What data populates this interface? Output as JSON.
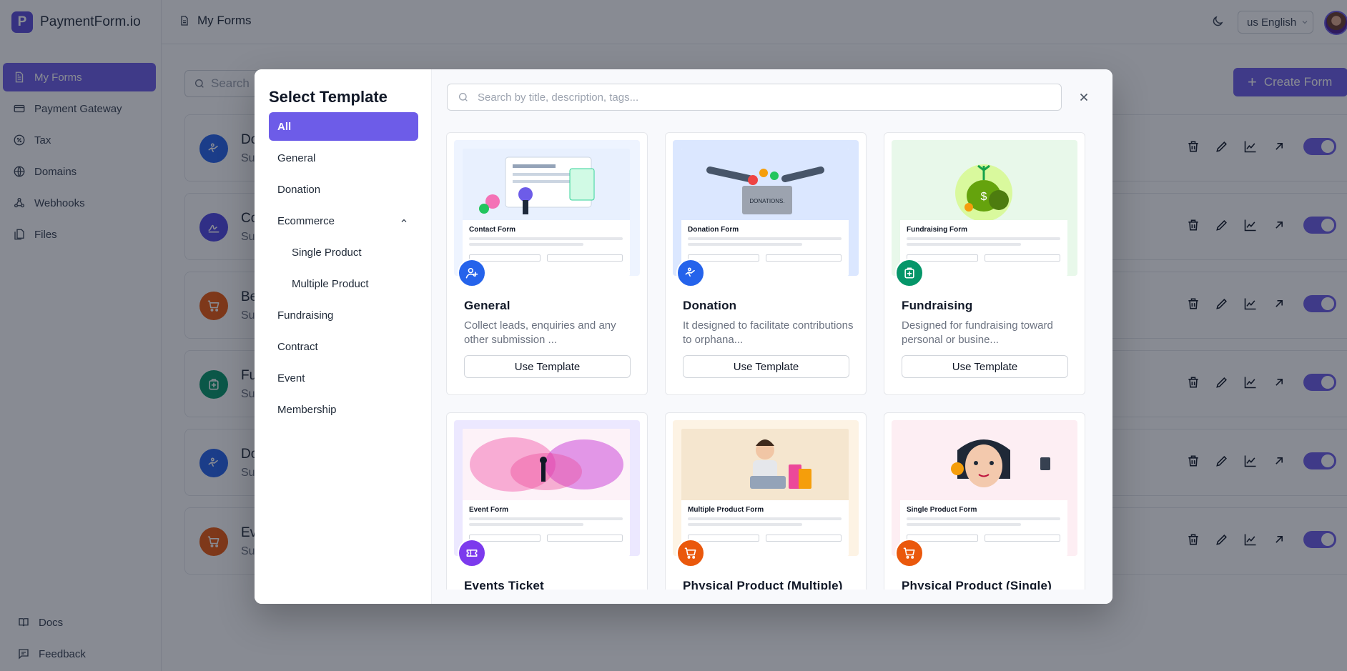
{
  "app": {
    "brand_letter": "P",
    "brand_name": "PaymentForm.io"
  },
  "sidebar": {
    "items": [
      {
        "label": "My Forms",
        "icon": "file-icon",
        "active": true
      },
      {
        "label": "Payment Gateway",
        "icon": "card-icon"
      },
      {
        "label": "Tax",
        "icon": "percent-icon"
      },
      {
        "label": "Domains",
        "icon": "globe-icon"
      },
      {
        "label": "Webhooks",
        "icon": "webhook-icon"
      },
      {
        "label": "Files",
        "icon": "files-icon"
      }
    ],
    "bottom": [
      {
        "label": "Docs",
        "icon": "book-icon"
      },
      {
        "label": "Feedback",
        "icon": "message-icon"
      }
    ]
  },
  "header": {
    "title": "My Forms",
    "language": "us English"
  },
  "main": {
    "search_placeholder": "Search",
    "create_label": "Create Form",
    "forms": [
      {
        "name": "Do",
        "sub": "Su",
        "icon": "donation-icon",
        "color": "#2563eb"
      },
      {
        "name": "Co",
        "sub": "Su",
        "icon": "signature-icon",
        "color": "#4f46e5"
      },
      {
        "name": "Be",
        "sub": "Su",
        "icon": "cart-icon",
        "color": "#ea580c"
      },
      {
        "name": "Fu",
        "sub": "Su",
        "icon": "fundraising-icon",
        "color": "#059669"
      },
      {
        "name": "Do",
        "sub": "Su",
        "icon": "donation-icon",
        "color": "#2563eb"
      },
      {
        "name": "Ev",
        "sub": "Su",
        "icon": "cart-icon",
        "color": "#ea580c"
      }
    ]
  },
  "modal": {
    "title": "Select Template",
    "search_placeholder": "Search by title, description, tags...",
    "categories": [
      {
        "label": "All",
        "active": true
      },
      {
        "label": "General"
      },
      {
        "label": "Donation"
      },
      {
        "label": "Ecommerce",
        "expanded": true
      },
      {
        "label": "Single Product",
        "sub": true
      },
      {
        "label": "Multiple Product",
        "sub": true
      },
      {
        "label": "Fundraising"
      },
      {
        "label": "Contract"
      },
      {
        "label": "Event"
      },
      {
        "label": "Membership"
      }
    ],
    "use_label": "Use Template",
    "templates": [
      {
        "name": "General",
        "desc": "Collect leads, enquiries and any other submission ...",
        "thumb_title": "Contact Form",
        "icon": "user-plus-icon",
        "color": "#2563eb",
        "bg": "#eef4ff"
      },
      {
        "name": "Donation",
        "desc": "It designed to facilitate contributions to orphana...",
        "thumb_title": "Donation Form",
        "icon": "donation-icon",
        "color": "#2563eb",
        "bg": "#dbe7ff"
      },
      {
        "name": "Fundraising",
        "desc": "Designed for fundraising toward personal or busine...",
        "thumb_title": "Fundraising Form",
        "icon": "fundraising-icon",
        "color": "#059669",
        "bg": "#e8f8ea"
      },
      {
        "name": "Events Ticket",
        "desc": "",
        "thumb_title": "Event Form",
        "icon": "ticket-icon",
        "color": "#7c3aed",
        "bg": "#ece8ff"
      },
      {
        "name": "Physical Product (Multiple)",
        "desc": "",
        "thumb_title": "Multiple Product Form",
        "icon": "cart-icon",
        "color": "#ea580c",
        "bg": "#fdf3e4"
      },
      {
        "name": "Physical Product (Single)",
        "desc": "",
        "thumb_title": "Single Product Form",
        "icon": "cart-icon",
        "color": "#ea580c",
        "bg": "#fdeef3"
      }
    ]
  }
}
